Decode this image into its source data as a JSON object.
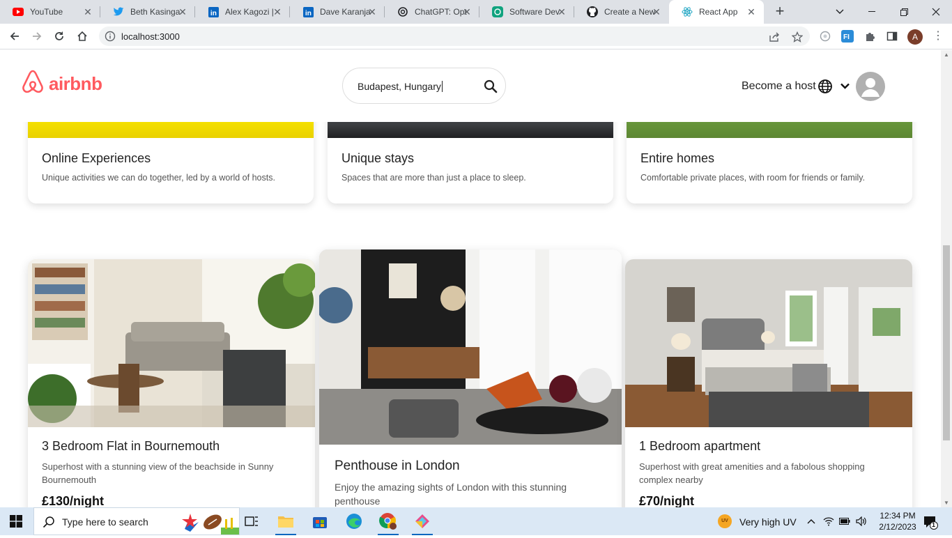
{
  "browser": {
    "tabs": [
      {
        "title": "YouTube",
        "icon": "youtube-icon",
        "color": "#ff0000"
      },
      {
        "title": "Beth Kasinga",
        "icon": "twitter-icon",
        "color": "#1d9bf0"
      },
      {
        "title": "Alex Kagozi |",
        "icon": "linkedin-icon",
        "color": "#0a66c2"
      },
      {
        "title": "Dave Karanja",
        "icon": "linkedin-icon",
        "color": "#0a66c2"
      },
      {
        "title": "ChatGPT: Opt",
        "icon": "openai-icon",
        "color": "#202124"
      },
      {
        "title": "Software Dev",
        "icon": "openai-icon",
        "color": "#10a37f"
      },
      {
        "title": "Create a New",
        "icon": "github-icon",
        "color": "#202124"
      },
      {
        "title": "React App",
        "icon": "react-icon",
        "color": "#23a7c4"
      }
    ],
    "active_tab": 7,
    "url": "localhost:3000"
  },
  "site": {
    "logo_text": "airbnb",
    "brand_color": "#ff5a5f",
    "search_value": "Budapest, Hungary",
    "host_link": "Become a host",
    "categories": [
      {
        "title": "Online Experiences",
        "description": "Unique activities we can do together, led by a world of hosts."
      },
      {
        "title": "Unique stays",
        "description": "Spaces that are more than just a place to sleep."
      },
      {
        "title": "Entire homes",
        "description": "Comfortable private places, with room for friends or family."
      }
    ],
    "listings": [
      {
        "title": "3 Bedroom Flat in Bournemouth",
        "description_lines": [
          "Superhost with a stunning view of the beachside in Sunny",
          "Bournemouth"
        ],
        "price": "£130/night"
      },
      {
        "title": "Penthouse in London",
        "description_lines": [
          "Enjoy the amazing sights of London with this stunning",
          "penthouse"
        ],
        "price": ""
      },
      {
        "title": "1 Bedroom apartment",
        "description_lines": [
          "Superhost with great amenities and a fabolous shopping",
          "complex nearby"
        ],
        "price": "£70/night"
      }
    ]
  },
  "taskbar": {
    "search_placeholder": "Type here to search",
    "weather": "Very high UV",
    "uv_badge": "UV",
    "time": "12:34 PM",
    "date": "2/12/2023",
    "notification_count": "1"
  }
}
